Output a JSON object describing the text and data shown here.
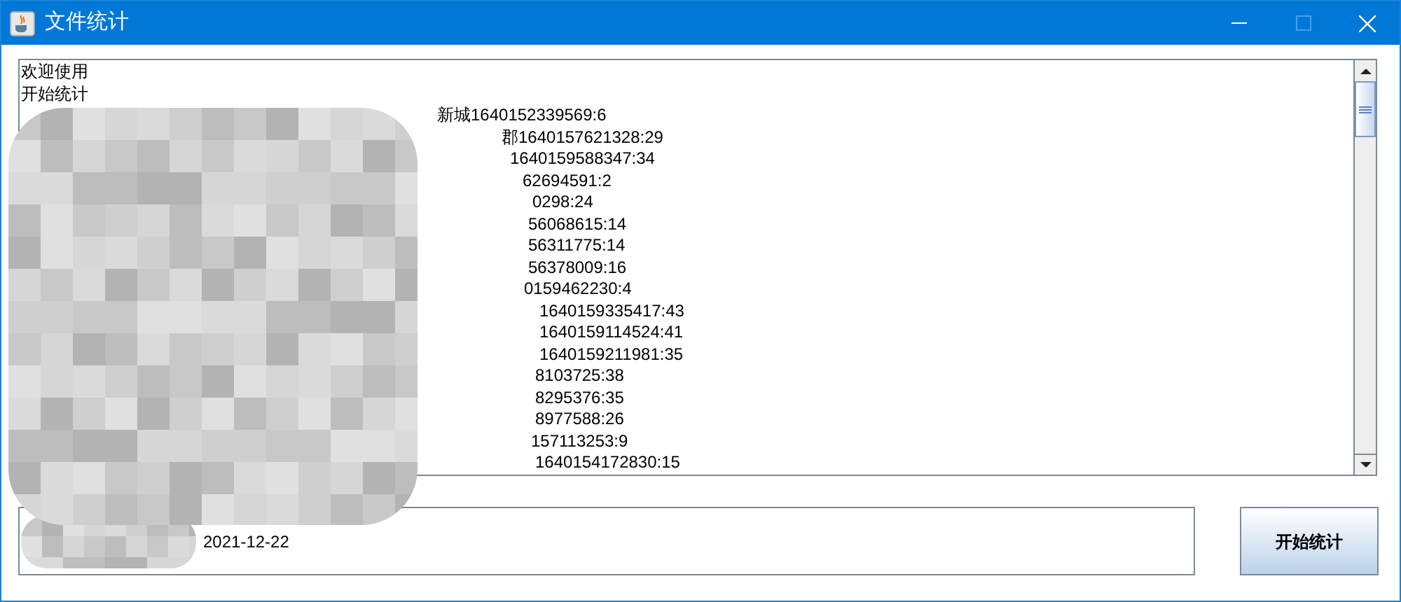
{
  "window": {
    "title": "文件统计"
  },
  "log": {
    "lines": [
      "欢迎使用",
      "开始统计"
    ],
    "line_tails": [
      "新城1640152339569:6",
      "郡1640157621328:29",
      "1640159588347:34",
      "62694591:2",
      "0298:24",
      "56068615:14",
      "56311775:14",
      "56378009:16",
      "0159462230:4",
      "1640159335417:43",
      "1640159114524:41",
      "1640159211981:35",
      "8103725:38",
      "8295376:35",
      "8977588:26",
      "157113253:9",
      "1640154172830:15"
    ]
  },
  "path_field": {
    "value": "2021-12-22"
  },
  "start_button": {
    "label": "开始统计"
  }
}
